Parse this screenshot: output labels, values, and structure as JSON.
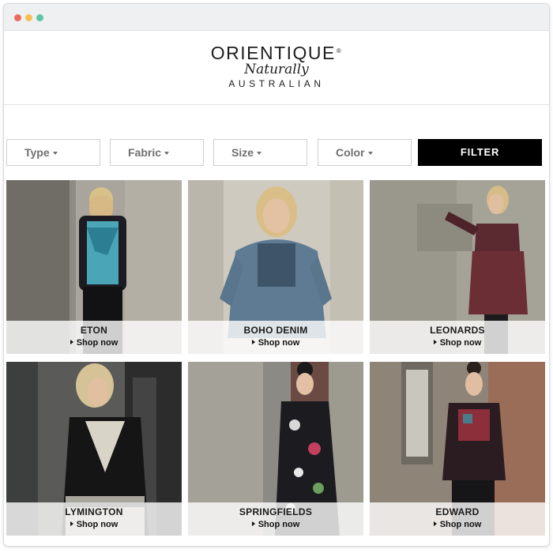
{
  "window": {
    "controls": [
      {
        "name": "close",
        "color": "#ec6b5e"
      },
      {
        "name": "minimize",
        "color": "#f4bf4f"
      },
      {
        "name": "zoom",
        "color": "#61c3a6"
      }
    ]
  },
  "brand": {
    "name": "ORIENTIQUE",
    "registered": "®",
    "tagline": "Naturally",
    "country": "AUSTRALIAN"
  },
  "filters": {
    "dropdowns": [
      {
        "label": "Type"
      },
      {
        "label": "Fabric"
      },
      {
        "label": "Size"
      },
      {
        "label": "Color"
      }
    ],
    "button_label": "FILTER"
  },
  "products": [
    {
      "name": "ETON",
      "cta": "Shop now"
    },
    {
      "name": "BOHO DENIM",
      "cta": "Shop now"
    },
    {
      "name": "LEONARDS",
      "cta": "Shop now"
    },
    {
      "name": "LYMINGTON",
      "cta": "Shop now"
    },
    {
      "name": "SPRINGFIELDS",
      "cta": "Shop now"
    },
    {
      "name": "EDWARD",
      "cta": "Shop now"
    }
  ],
  "colors": {
    "filter_button_bg": "#000000",
    "dropdown_text": "#707070",
    "title_bar": "#eef0f2"
  }
}
